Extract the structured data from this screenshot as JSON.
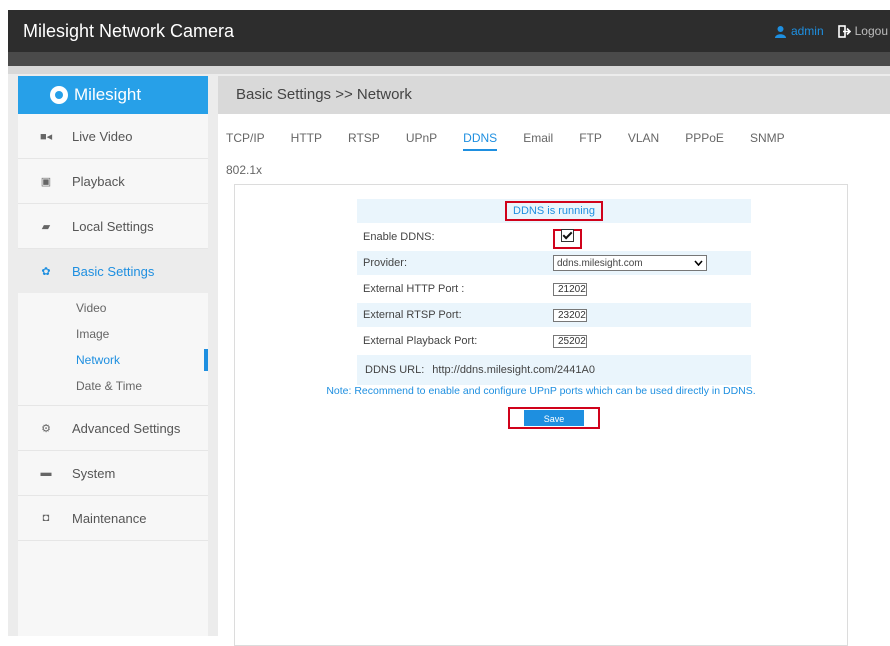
{
  "app": {
    "title": "Milesight Network Camera"
  },
  "header": {
    "user": "admin",
    "logout": "Logou"
  },
  "brand": {
    "name": "Milesight",
    "accent": "#27a0e8"
  },
  "sidebar": {
    "items": [
      {
        "label": "Live Video",
        "icon": "video-camera-icon"
      },
      {
        "label": "Playback",
        "icon": "playback-icon"
      },
      {
        "label": "Local Settings",
        "icon": "folder-icon"
      },
      {
        "label": "Basic Settings",
        "icon": "gear-icon"
      },
      {
        "label": "Advanced Settings",
        "icon": "advanced-gears-icon"
      },
      {
        "label": "System",
        "icon": "monitor-icon"
      },
      {
        "label": "Maintenance",
        "icon": "toolbox-icon"
      }
    ],
    "sub_items": [
      "Video",
      "Image",
      "Network",
      "Date & Time"
    ]
  },
  "breadcrumb": "Basic Settings >> Network",
  "tabs": [
    "TCP/IP",
    "HTTP",
    "RTSP",
    "UPnP",
    "DDNS",
    "Email",
    "FTP",
    "VLAN",
    "PPPoE",
    "SNMP",
    "802.1x"
  ],
  "form": {
    "status": "DDNS is running",
    "enable_label": "Enable DDNS:",
    "enable_checked": true,
    "provider_label": "Provider:",
    "provider_value": "ddns.milesight.com",
    "http_port_label": "External HTTP Port :",
    "http_port_value": "21202",
    "rtsp_port_label": "External RTSP Port:",
    "rtsp_port_value": "23202",
    "playback_port_label": "External Playback Port:",
    "playback_port_value": "25202",
    "url_label": "DDNS URL:",
    "url_value": "http://ddns.milesight.com/2441A0"
  },
  "note": "Note: Recommend to enable and configure UPnP ports which can be used directly in DDNS.",
  "save_label": "Save",
  "colors": {
    "highlight": "#d0021b",
    "link": "#1e8fe0"
  }
}
